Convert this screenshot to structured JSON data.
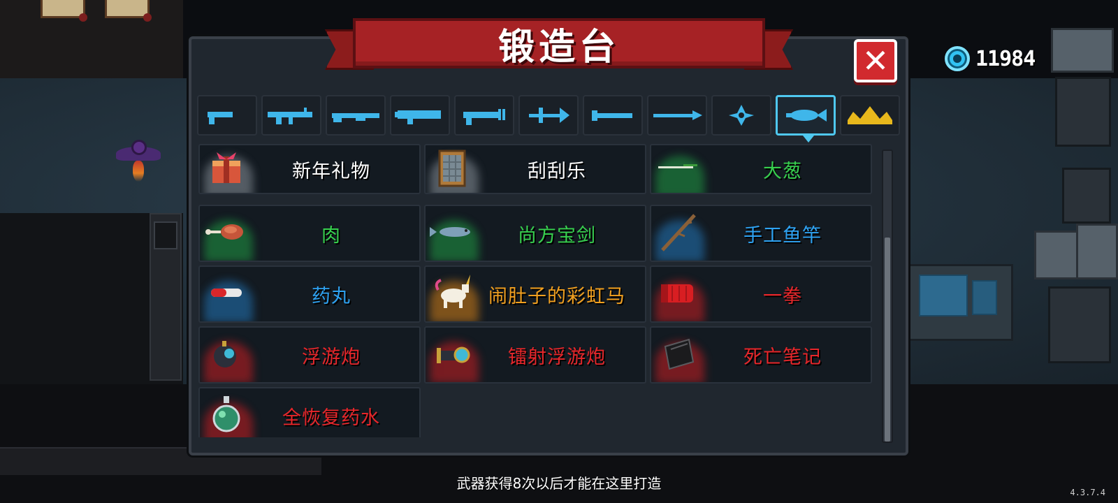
{
  "title": "锻造台",
  "currency": {
    "icon": "blue-gem-icon",
    "value": "11984"
  },
  "close": {
    "icon": "close-x-icon",
    "label": "✕"
  },
  "tabs": [
    {
      "icon": "pistol-icon",
      "active": false
    },
    {
      "icon": "assault-rifle-icon",
      "active": false
    },
    {
      "icon": "shotgun-icon",
      "active": false
    },
    {
      "icon": "launcher-icon",
      "active": false
    },
    {
      "icon": "laser-gun-icon",
      "active": false
    },
    {
      "icon": "bow-icon",
      "active": false
    },
    {
      "icon": "sword-icon",
      "active": false
    },
    {
      "icon": "spear-icon",
      "active": false
    },
    {
      "icon": "shuriken-icon",
      "active": false
    },
    {
      "icon": "fish-icon",
      "active": true
    },
    {
      "icon": "crown-icon",
      "active": false
    }
  ],
  "items": [
    {
      "name": "新年礼物",
      "rarity": "white",
      "icon": "gift-box-icon"
    },
    {
      "name": "刮刮乐",
      "rarity": "white",
      "icon": "scratch-card-icon"
    },
    {
      "name": "大葱",
      "rarity": "green",
      "icon": "leek-icon"
    },
    {
      "name": "肉",
      "rarity": "green",
      "icon": "meat-drumstick-icon"
    },
    {
      "name": "尚方宝剑",
      "rarity": "green",
      "icon": "fish-sword-icon"
    },
    {
      "name": "手工鱼竿",
      "rarity": "blue",
      "icon": "fishing-rod-icon"
    },
    {
      "name": "药丸",
      "rarity": "blue",
      "icon": "pill-icon"
    },
    {
      "name": "闹肚子的彩虹马",
      "rarity": "orange",
      "icon": "rainbow-unicorn-icon"
    },
    {
      "name": "一拳",
      "rarity": "red",
      "icon": "red-fist-icon"
    },
    {
      "name": "浮游炮",
      "rarity": "red",
      "icon": "floating-drone-icon"
    },
    {
      "name": "镭射浮游炮",
      "rarity": "red",
      "icon": "laser-drone-icon"
    },
    {
      "name": "死亡笔记",
      "rarity": "red",
      "icon": "death-note-icon"
    },
    {
      "name": "全恢复药水",
      "rarity": "red",
      "icon": "potion-flask-icon"
    }
  ],
  "hint": "武器获得8次以后才能在这里打造",
  "version": "4.3.7.4",
  "colors": {
    "white": "#ffffff",
    "green": "#37d04e",
    "blue": "#2ea2f2",
    "orange": "#f2a01f",
    "red": "#e8262a",
    "tab_icon": "#3fb6ea",
    "crown": "#e8b81c"
  }
}
